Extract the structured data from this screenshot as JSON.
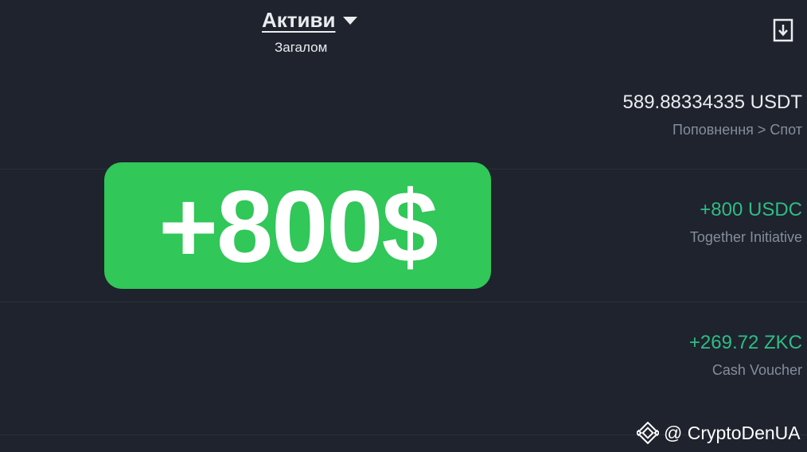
{
  "header": {
    "title": "Активи",
    "subtitle": "Загалом"
  },
  "icons": {
    "dropdown": "caret-down-icon",
    "download": "download-icon",
    "watermark_logo": "binance-logo-icon"
  },
  "transactions": [
    {
      "amount": "589.88334335 USDT",
      "description": "Поповнення > Спот",
      "status": "neutral"
    },
    {
      "amount": "+800 USDC",
      "description": "Together Initiative",
      "status": "positive"
    },
    {
      "amount": "+269.72 ZKC",
      "description": "Cash Voucher",
      "status": "positive"
    }
  ],
  "overlay": {
    "label": "+800$"
  },
  "watermark": {
    "handle": "@ CryptoDenUA"
  },
  "colors": {
    "background": "#1f232d",
    "positive": "#2ebd85",
    "neutral_text": "#eaecef",
    "muted_text": "#848e9c",
    "badge": "#31c759"
  }
}
